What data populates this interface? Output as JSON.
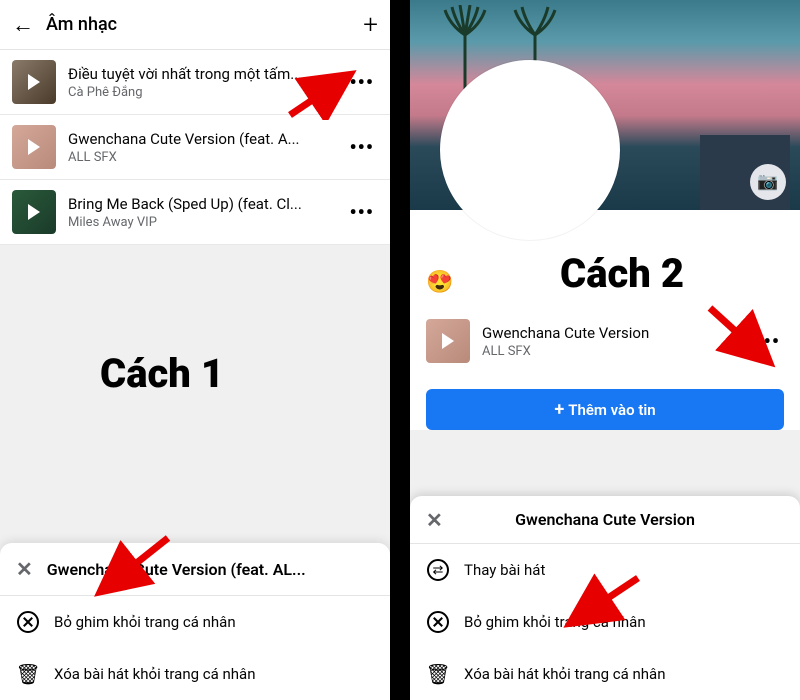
{
  "labels": {
    "method1": "Cách 1",
    "method2": "Cách 2"
  },
  "left": {
    "header": {
      "title": "Âm nhạc"
    },
    "songs": [
      {
        "title": "Điều tuyệt vời nhất trong một tấm...",
        "artist": "Cà Phê Đắng"
      },
      {
        "title": "Gwenchana Cute Version (feat. A...",
        "artist": "ALL SFX"
      },
      {
        "title": "Bring Me Back (Sped Up) (feat. Cl...",
        "artist": "Miles Away VIP"
      }
    ],
    "sheet": {
      "title": "Gwenchana Cute Version (feat. AL...",
      "unpin": "Bỏ ghim khỏi trang cá nhân",
      "delete": "Xóa bài hát khỏi trang cá nhân"
    }
  },
  "right": {
    "emoji": "😍",
    "pinned": {
      "title": "Gwenchana Cute Version",
      "artist": "ALL SFX"
    },
    "addStory": "Thêm vào tin",
    "sheet": {
      "title": "Gwenchana Cute Version",
      "change": "Thay bài hát",
      "unpin": "Bỏ ghim khỏi trang cá nhân",
      "delete": "Xóa bài hát khỏi trang cá nhân"
    }
  }
}
